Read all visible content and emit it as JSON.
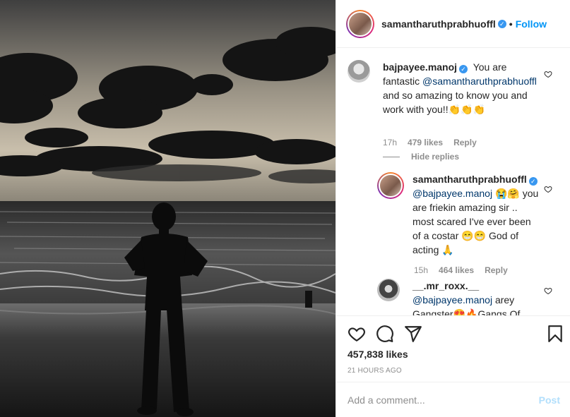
{
  "post": {
    "author": "samantharuthprabhuoffl",
    "separator": "•",
    "follow_label": "Follow",
    "likes": "457,838 likes",
    "time_ago": "21 HOURS AGO",
    "add_comment_placeholder": "Add a comment...",
    "post_label": "Post"
  },
  "comments": [
    {
      "username": "bajpayee.manoj",
      "verified": true,
      "text_a": "You are fantastic",
      "mention": "@samantharuthprabhuoffl",
      "text_b": " and so amazing to know you and work with you!!👏👏👏",
      "time": "17h",
      "likes": "479 likes",
      "reply_label": "Reply",
      "hide_replies_label": "Hide replies"
    }
  ],
  "replies": [
    {
      "username": "samantharuthprabhuoffl",
      "verified": true,
      "mention": "@bajpayee.manoj",
      "text": " 😭🤗 you are friekin amazing sir .. most scared I've ever been of a costar 😁😁 God of acting 🙏",
      "time": "15h",
      "likes": "464 likes",
      "reply_label": "Reply"
    },
    {
      "username": "__.mr_roxx.__",
      "mention": "@bajpayee.manoj",
      "text": " arey Gangster😍🔥Gangs Of"
    }
  ],
  "icons": {
    "like": "heart-icon",
    "comment": "comment-icon",
    "share": "paper-plane-icon",
    "save": "bookmark-icon",
    "comment_like": "heart-icon"
  },
  "colors": {
    "accent": "#0095f6",
    "post_disabled": "#b2dffc",
    "muted": "#8e8e8e"
  }
}
